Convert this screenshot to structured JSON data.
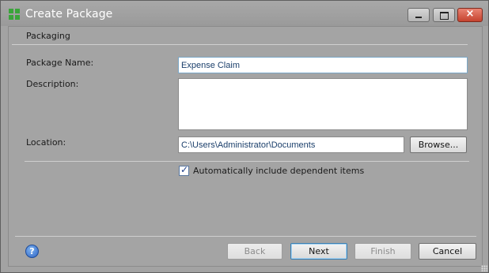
{
  "window": {
    "title": "Create Package",
    "close_glyph": "×",
    "icons": {
      "app": "package-app-icon",
      "minimize": "minimize-icon",
      "maximize": "maximize-icon",
      "close": "close-icon"
    }
  },
  "section": {
    "title": "Packaging"
  },
  "form": {
    "package_name": {
      "label": "Package Name:",
      "value": "Expense Claim"
    },
    "description": {
      "label": "Description:",
      "value": ""
    },
    "location": {
      "label": "Location:",
      "value": "C:\\Users\\Administrator\\Documents",
      "browse_label": "Browse..."
    },
    "auto_include": {
      "label": "Automatically include dependent items",
      "checked": true
    }
  },
  "footer": {
    "help_glyph": "?",
    "buttons": {
      "back": {
        "label": "Back",
        "enabled": false
      },
      "next": {
        "label": "Next",
        "enabled": true
      },
      "finish": {
        "label": "Finish",
        "enabled": false
      },
      "cancel": {
        "label": "Cancel",
        "enabled": true
      }
    }
  },
  "colors": {
    "title_text": "#ffffff",
    "dialog_bg": "#a4a4a4",
    "input_border": "#7aa7c7",
    "input_text": "#1b3f6b",
    "app_icon": "#3aa53a"
  }
}
